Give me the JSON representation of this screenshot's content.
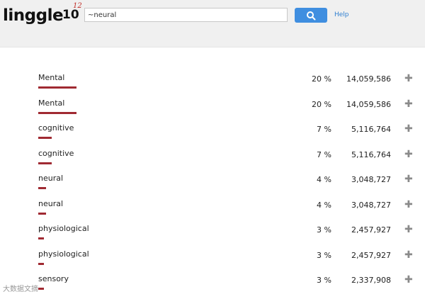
{
  "header": {
    "logo_text": "linggle",
    "logo_version": "10",
    "logo_superscript": "12",
    "search_value": "~neural",
    "help_label": "Help"
  },
  "icons": {
    "search": "search-icon",
    "expand": "plus-icon"
  },
  "colors": {
    "bar": "#a02a32",
    "search_button": "#3f8ee0",
    "help_link": "#2f7fd0"
  },
  "results": [
    {
      "word": "Mental",
      "percent": "20 %",
      "count": "14,059,586",
      "share": 0.2
    },
    {
      "word": "Mental",
      "percent": "20 %",
      "count": "14,059,586",
      "share": 0.2
    },
    {
      "word": "cognitive",
      "percent": "7 %",
      "count": "5,116,764",
      "share": 0.07
    },
    {
      "word": "cognitive",
      "percent": "7 %",
      "count": "5,116,764",
      "share": 0.07
    },
    {
      "word": "neural",
      "percent": "4 %",
      "count": "3,048,727",
      "share": 0.04
    },
    {
      "word": "neural",
      "percent": "4 %",
      "count": "3,048,727",
      "share": 0.04
    },
    {
      "word": "physiological",
      "percent": "3 %",
      "count": "2,457,927",
      "share": 0.03
    },
    {
      "word": "physiological",
      "percent": "3 %",
      "count": "2,457,927",
      "share": 0.03
    },
    {
      "word": "sensory",
      "percent": "3 %",
      "count": "2,337,908",
      "share": 0.03
    }
  ],
  "watermark": "大数据文摘"
}
